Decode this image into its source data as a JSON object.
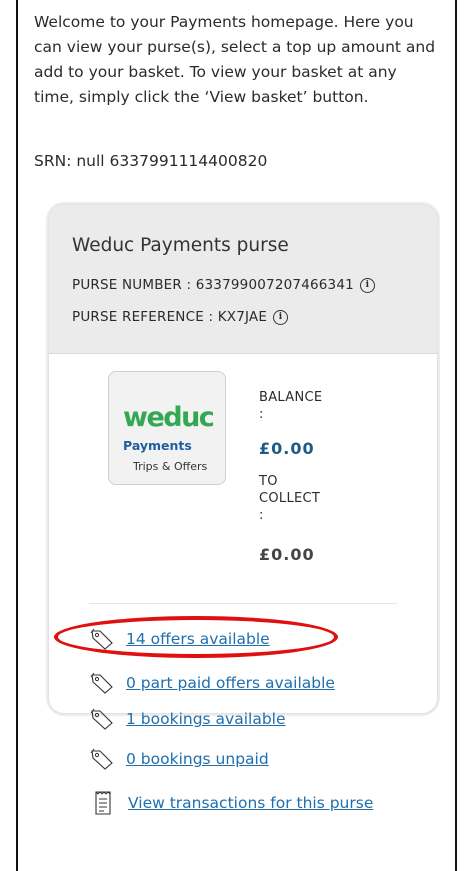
{
  "intro": {
    "text": "Welcome to your Payments homepage. Here you can view your purse(s), select a top up amount and add to your basket. To view your basket at any time, simply click the ‘View basket’ button.",
    "srn": "SRN: null 6337991114400820"
  },
  "purse": {
    "title": "Weduc Payments purse",
    "number_label": "PURSE NUMBER : 633799007207466341",
    "reference_label": "PURSE REFERENCE : KX7JAE",
    "logo": {
      "main": "weduc",
      "sub1": "Payments",
      "sub2": "Trips & Offers"
    },
    "balance_label_line1": "BALANCE",
    "balance_label_line2": ":",
    "balance_value": "£0.00",
    "balance_color": "#1f5a82",
    "collect_label_line1": "TO",
    "collect_label_line2": "COLLECT",
    "collect_label_line3": ":",
    "collect_value": "£0.00",
    "collect_color": "#444444"
  },
  "links": [
    {
      "label": "14 offers available",
      "icon": "tag-icon"
    },
    {
      "label": "0 part paid offers available",
      "icon": "tag-icon"
    },
    {
      "label": "1 bookings available",
      "icon": "tag-icon"
    },
    {
      "label": "0 bookings unpaid",
      "icon": "tag-icon"
    },
    {
      "label": "View transactions for this purse",
      "icon": "receipt-icon"
    }
  ],
  "colors": {
    "link": "#1f6fae",
    "highlight": "#e01010",
    "logo_green": "#32a852"
  }
}
